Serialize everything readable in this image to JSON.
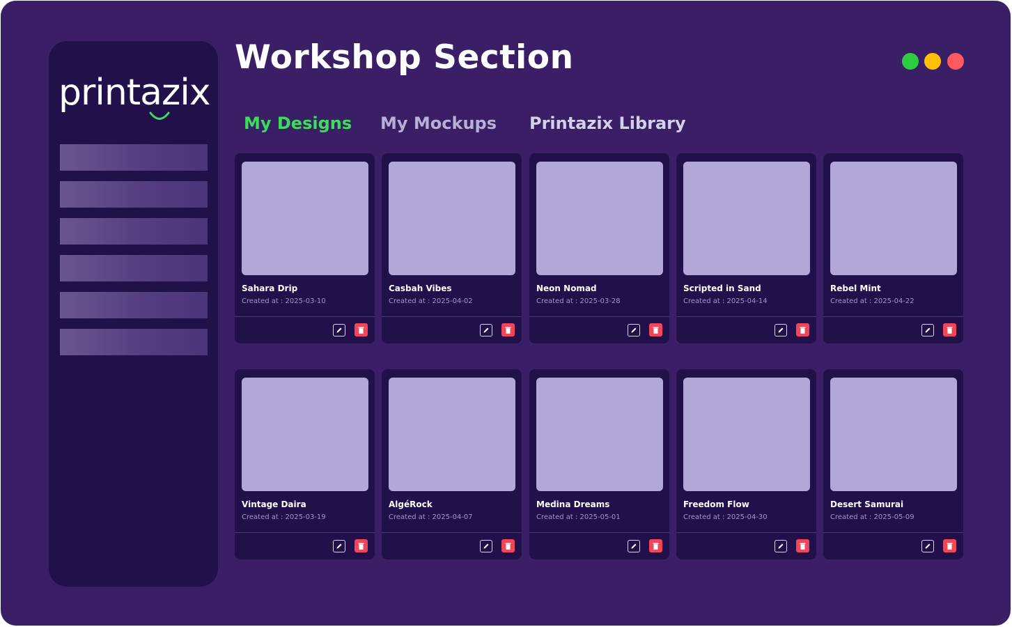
{
  "app": {
    "logo_text": "printazix",
    "page_title": "Workshop Section"
  },
  "window_controls": {
    "colors": [
      "#2ecc40",
      "#ffc107",
      "#ff5a5f"
    ]
  },
  "sidebar": {
    "placeholder_item_count": 6
  },
  "tabs": [
    {
      "label": "My Designs",
      "active": true,
      "color": "#3ddc5a"
    },
    {
      "label": "My Mockups",
      "active": false,
      "color": "#b8aed6"
    },
    {
      "label": "Printazix Library",
      "active": false,
      "color": "#d6cfea"
    }
  ],
  "cards": [
    {
      "name": "Sahara Drip",
      "created": "Created at : 2025-03-10"
    },
    {
      "name": "Casbah Vibes",
      "created": "Created at : 2025-04-02"
    },
    {
      "name": "Neon Nomad",
      "created": "Created at : 2025-03-28"
    },
    {
      "name": "Scripted in Sand",
      "created": "Created at : 2025-04-14"
    },
    {
      "name": "Rebel Mint",
      "created": "Created at : 2025-04-22"
    },
    {
      "name": "Vintage Daira",
      "created": "Created at : 2025-03-19"
    },
    {
      "name": "AlgéRock",
      "created": "Created at : 2025-04-07"
    },
    {
      "name": "Medina Dreams",
      "created": "Created at : 2025-05-01"
    },
    {
      "name": "Freedom Flow",
      "created": "Created at : 2025-04-30"
    },
    {
      "name": "Desert Samurai",
      "created": "Created at : 2025-05-09"
    }
  ],
  "card_actions": {
    "edit_icon": "pencil-icon",
    "delete_icon": "trash-icon",
    "delete_color": "#f0465a"
  }
}
